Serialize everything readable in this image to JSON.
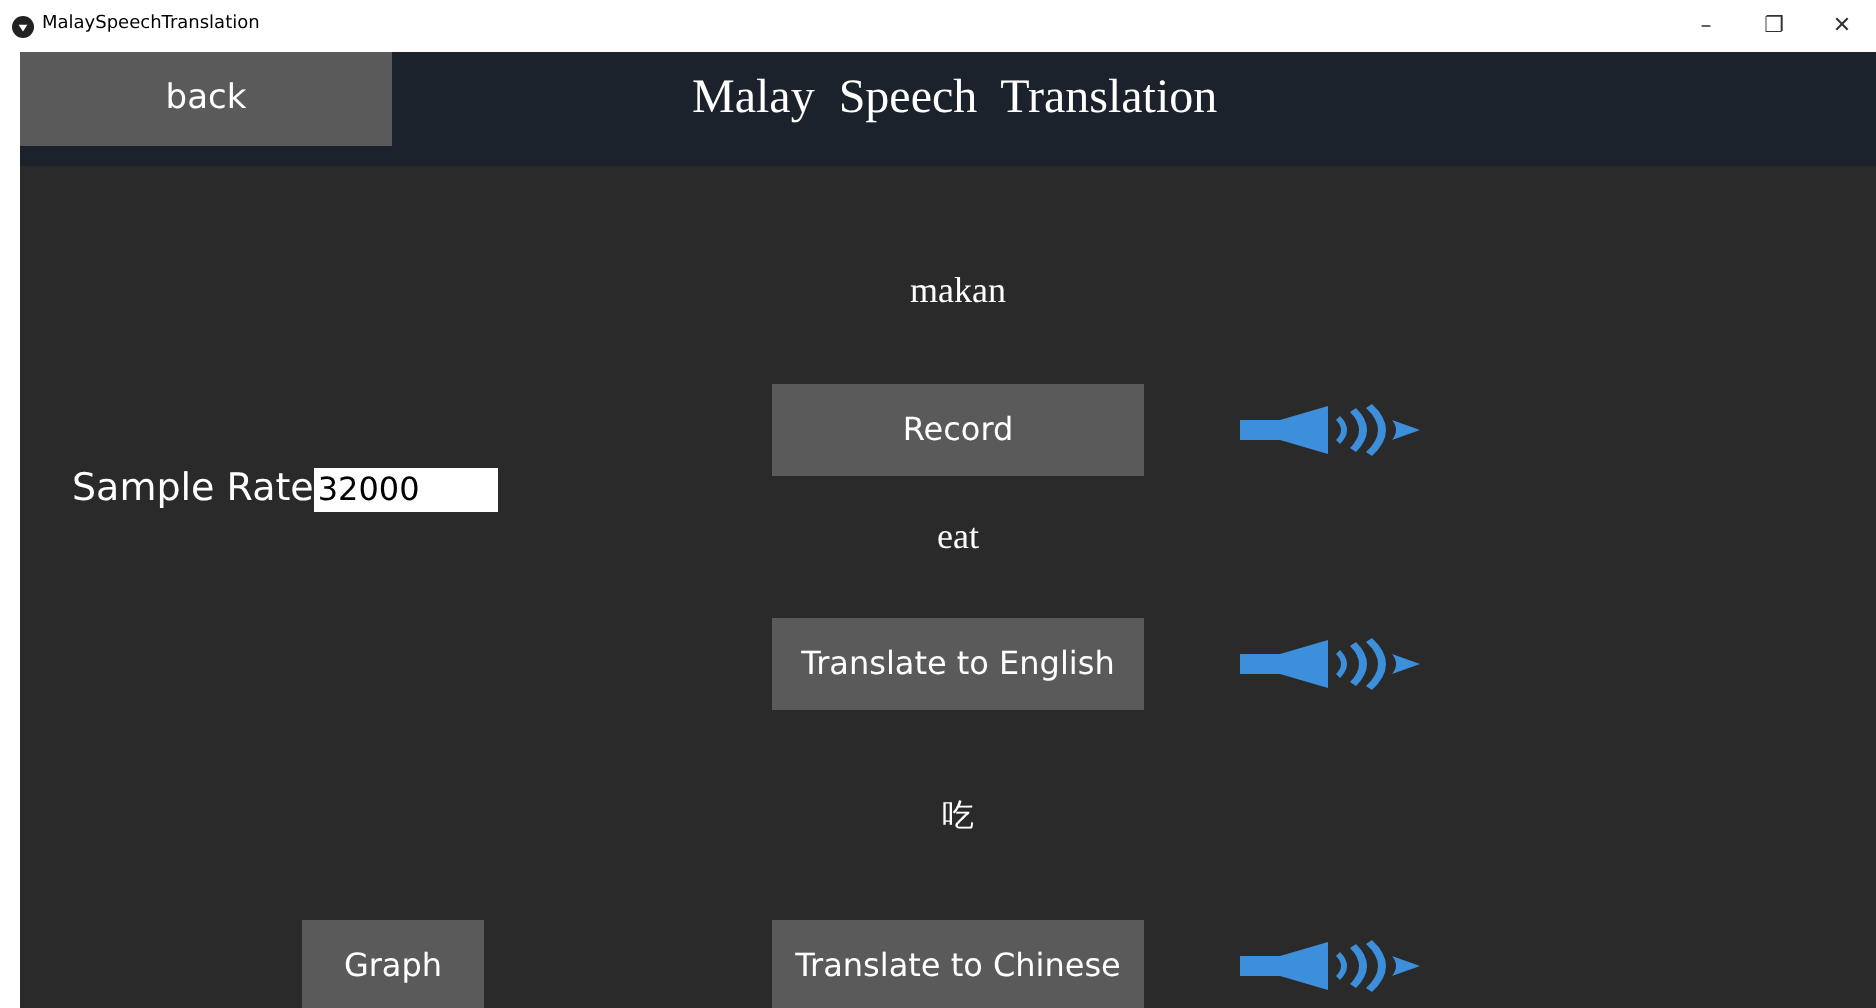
{
  "window": {
    "title": "MalaySpeechTranslation",
    "controls": [
      "–",
      "❐",
      "✕"
    ]
  },
  "header": {
    "back_button": "back",
    "title": "Malay  Speech  Translation"
  },
  "malay_text": "makan",
  "record_button": "Record",
  "sample_rate": {
    "label": "Sample Rate",
    "value": "32000"
  },
  "english_text": "eat",
  "translate_english_button": "Translate to English",
  "chinese_text": "吃",
  "graph_button": "Graph",
  "translate_chinese_button": "Translate to Chinese"
}
